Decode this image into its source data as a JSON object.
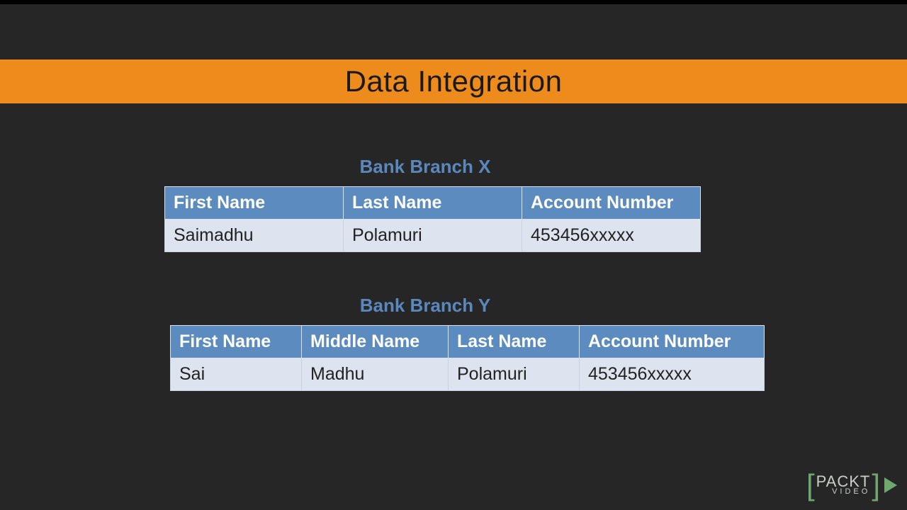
{
  "title": "Data Integration",
  "tables": {
    "branchX": {
      "caption": "Bank Branch X",
      "headers": [
        "First Name",
        "Last Name",
        "Account Number"
      ],
      "rows": [
        {
          "first": "Saimadhu",
          "last": "Polamuri",
          "account": "453456xxxxx"
        }
      ]
    },
    "branchY": {
      "caption": "Bank Branch Y",
      "headers": [
        "First Name",
        "Middle Name",
        "Last Name",
        "Account Number"
      ],
      "rows": [
        {
          "first": "Sai",
          "middle": "Madhu",
          "last": "Polamuri",
          "account": "453456xxxxx"
        }
      ]
    }
  },
  "logo": {
    "brand": "PACKT",
    "sub": "VIDEO"
  },
  "colors": {
    "accent": "#ed8b1d",
    "tableHeader": "#5b8bbf",
    "captions": "#5a88bd"
  }
}
